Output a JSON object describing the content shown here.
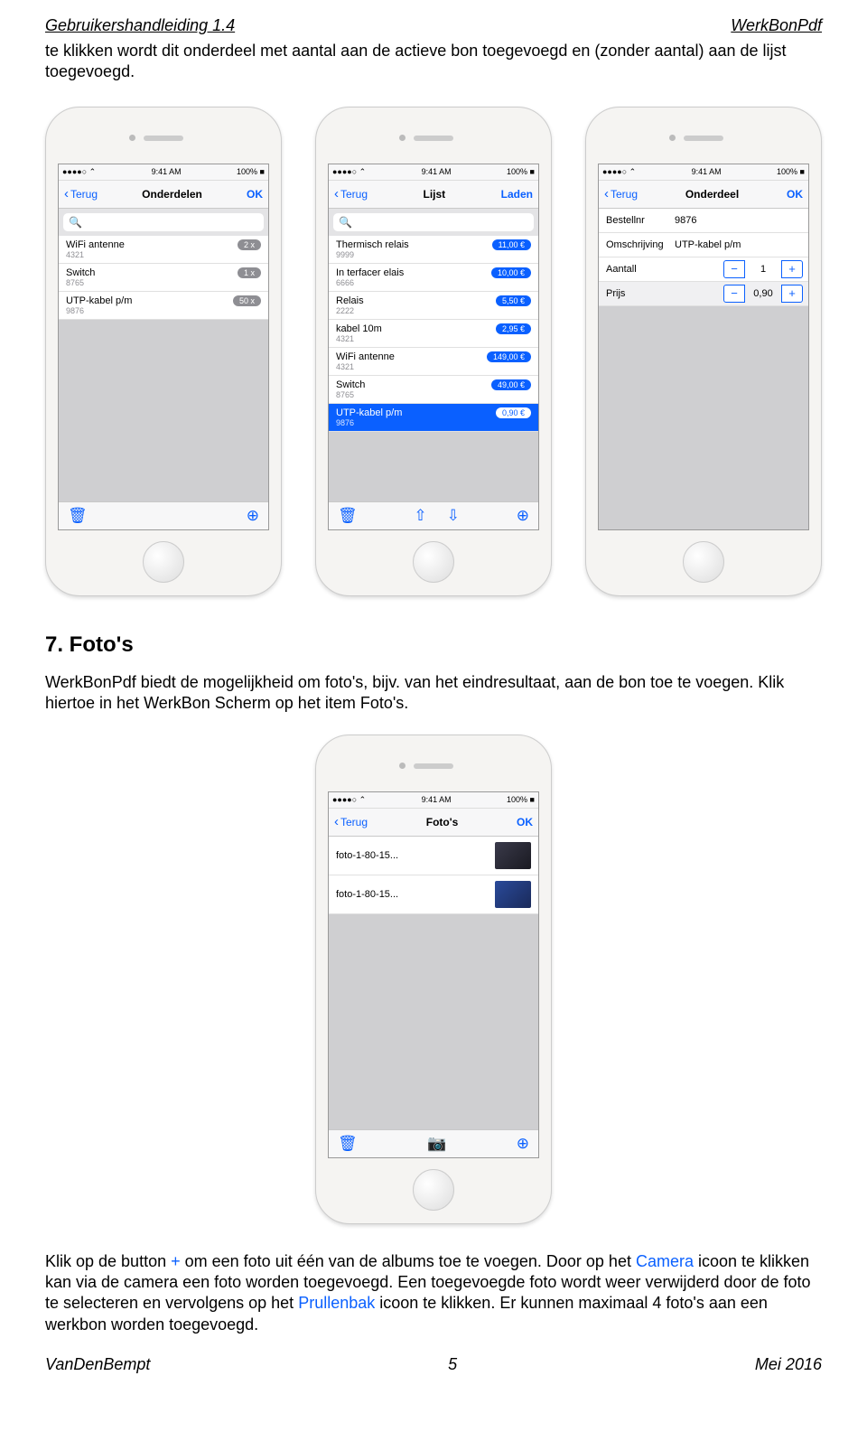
{
  "header": {
    "left": "Gebruikershandleiding 1.4",
    "right": "WerkBonPdf"
  },
  "intro": "te klikken wordt dit onderdeel met aantal aan de actieve bon toegevoegd en (zonder aantal) aan de lijst toegevoegd.",
  "status": {
    "carrier": "●●●●○ ⌃",
    "time": "9:41 AM",
    "batt": "100% ■"
  },
  "nav": {
    "back": "Terug"
  },
  "p1": {
    "title": "Onderdelen",
    "right": "OK",
    "items": [
      {
        "name": "WiFi antenne",
        "code": "4321",
        "badge": "2 x"
      },
      {
        "name": "Switch",
        "code": "8765",
        "badge": "1 x"
      },
      {
        "name": "UTP-kabel p/m",
        "code": "9876",
        "badge": "50 x"
      }
    ]
  },
  "p2": {
    "title": "Lijst",
    "right": "Laden",
    "items": [
      {
        "name": "Thermisch relais",
        "code": "9999",
        "price": "11,00 €"
      },
      {
        "name": "In terfacer elais",
        "code": "6666",
        "price": "10,00 €"
      },
      {
        "name": "Relais",
        "code": "2222",
        "price": "5,50 €"
      },
      {
        "name": "kabel 10m",
        "code": "4321",
        "price": "2,95 €"
      },
      {
        "name": "WiFi antenne",
        "code": "4321",
        "price": "149,00 €"
      },
      {
        "name": "Switch",
        "code": "8765",
        "price": "49,00 €"
      },
      {
        "name": "UTP-kabel p/m",
        "code": "9876",
        "price": "0,90 €",
        "sel": true
      }
    ]
  },
  "p3": {
    "title": "Onderdeel",
    "right": "OK",
    "fields": {
      "bestel_lbl": "Bestellnr",
      "bestel_val": "9876",
      "oms_lbl": "Omschrijving",
      "oms_val": "UTP-kabel p/m",
      "aantal_lbl": "Aantall",
      "aantal_val": "1",
      "prijs_lbl": "Prijs",
      "prijs_val": "0,90"
    }
  },
  "section": {
    "heading": "7. Foto's"
  },
  "para1": "WerkBonPdf biedt de mogelijkheid om foto's, bijv. van het eindresultaat, aan de bon toe te voegen. Klik hiertoe in het WerkBon Scherm op het item Foto's.",
  "p4": {
    "title": "Foto's",
    "right": "OK",
    "items": [
      {
        "name": "foto-1-80-15..."
      },
      {
        "name": "foto-1-80-15..."
      }
    ]
  },
  "para2": {
    "t1": "Klik op de button ",
    "plus": "+",
    "t2": " om een foto uit één van de albums toe te voegen. Door op het ",
    "cam": "Camera",
    "t3": " icoon te klikken kan via de camera een foto worden toegevoegd. Een toegevoegde foto wordt weer verwijderd door de foto te selecteren en vervolgens op het ",
    "trash": "Prullenbak",
    "t4": " icoon te klikken. Er kunnen maximaal 4 foto's aan een werkbon worden toegevoegd."
  },
  "footer": {
    "left": "VanDenBempt",
    "center": "5",
    "right": "Mei 2016"
  },
  "icons": {
    "minus": "−",
    "plusbtn": "+",
    "share": "⇧",
    "download": "⇩",
    "camera": "📷",
    "trash": "🗑",
    "add": "⊕"
  }
}
